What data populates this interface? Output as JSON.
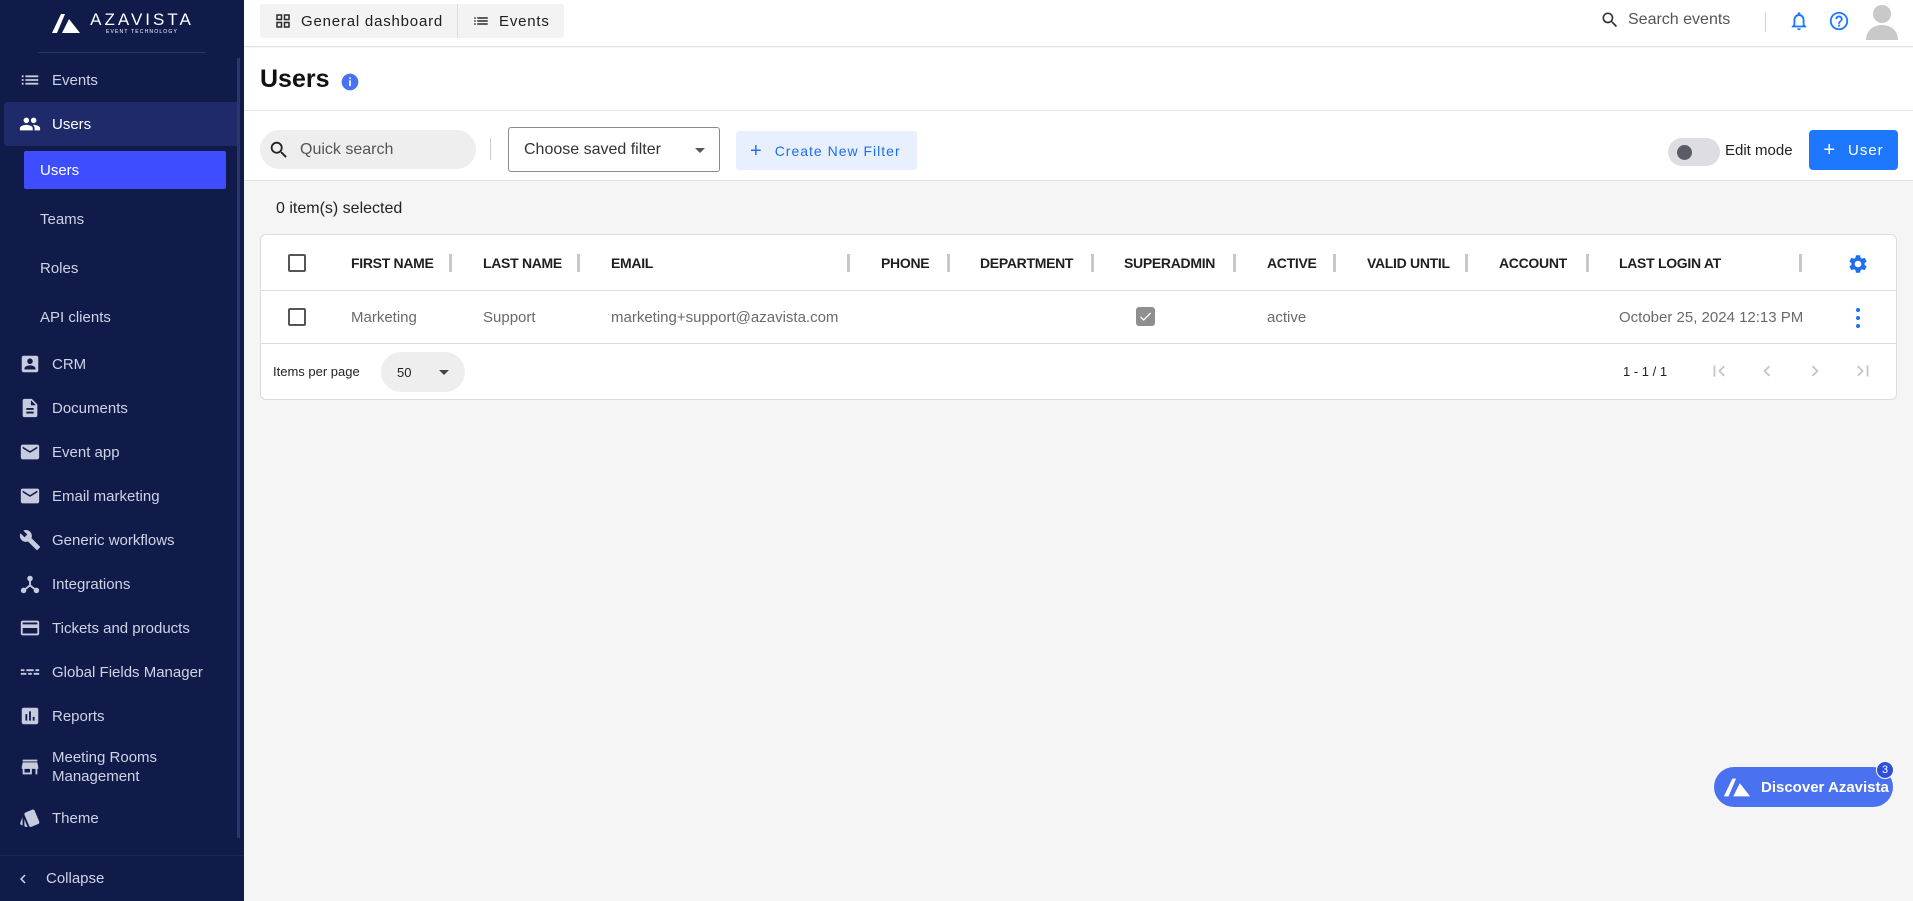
{
  "brand": {
    "name": "AZAVISTA",
    "tagline": "EVENT TECHNOLOGY"
  },
  "sidebar": {
    "items": [
      {
        "label": "Events",
        "icon": "list-icon"
      },
      {
        "label": "Users",
        "icon": "users-icon"
      },
      {
        "label": "CRM",
        "icon": "contact-card-icon"
      },
      {
        "label": "Documents",
        "icon": "document-icon"
      },
      {
        "label": "Event app",
        "icon": "mail-icon"
      },
      {
        "label": "Email marketing",
        "icon": "mail-icon"
      },
      {
        "label": "Generic workflows",
        "icon": "wrench-icon"
      },
      {
        "label": "Integrations",
        "icon": "integrations-icon"
      },
      {
        "label": "Tickets and products",
        "icon": "credit-card-icon"
      },
      {
        "label": "Global Fields Manager",
        "icon": "fields-icon"
      },
      {
        "label": "Reports",
        "icon": "bar-chart-icon"
      },
      {
        "label": "Meeting Rooms Management",
        "icon": "store-icon"
      },
      {
        "label": "Theme",
        "icon": "theme-icon"
      }
    ],
    "sub_items": [
      {
        "label": "Users"
      },
      {
        "label": "Teams"
      },
      {
        "label": "Roles"
      },
      {
        "label": "API clients"
      }
    ],
    "collapse_label": "Collapse"
  },
  "topbar": {
    "tabs": [
      {
        "label": "General dashboard",
        "icon": "dashboard-icon"
      },
      {
        "label": "Events",
        "icon": "list-icon"
      }
    ],
    "search_label": "Search events"
  },
  "page": {
    "title": "Users"
  },
  "toolbar": {
    "quick_search_placeholder": "Quick search",
    "saved_filter_label": "Choose saved filter",
    "create_filter_label": "Create New Filter",
    "edit_mode_label": "Edit mode",
    "edit_mode_on": false,
    "add_user_label": "User"
  },
  "selection": {
    "count_text": "0 item(s) selected"
  },
  "table": {
    "columns": [
      "FIRST NAME",
      "LAST NAME",
      "EMAIL",
      "PHONE",
      "DEPARTMENT",
      "SUPERADMIN",
      "ACTIVE",
      "VALID UNTIL",
      "ACCOUNT",
      "LAST LOGIN AT"
    ],
    "rows": [
      {
        "first_name": "Marketing",
        "last_name": "Support",
        "email": "marketing+support@azavista.com",
        "phone": "",
        "department": "",
        "superadmin": true,
        "active": "active",
        "valid_until": "",
        "account": "",
        "last_login_at": "October 25, 2024 12:13 PM"
      }
    ],
    "footer": {
      "items_per_page_label": "Items per page",
      "items_per_page_value": "50",
      "range": "1 - 1 / 1"
    }
  },
  "discover": {
    "label": "Discover Azavista",
    "badge": "3"
  },
  "colors": {
    "sidebar_bg": "#111b4a",
    "accent": "#1e78ff",
    "active_sub": "#3d4dff"
  }
}
